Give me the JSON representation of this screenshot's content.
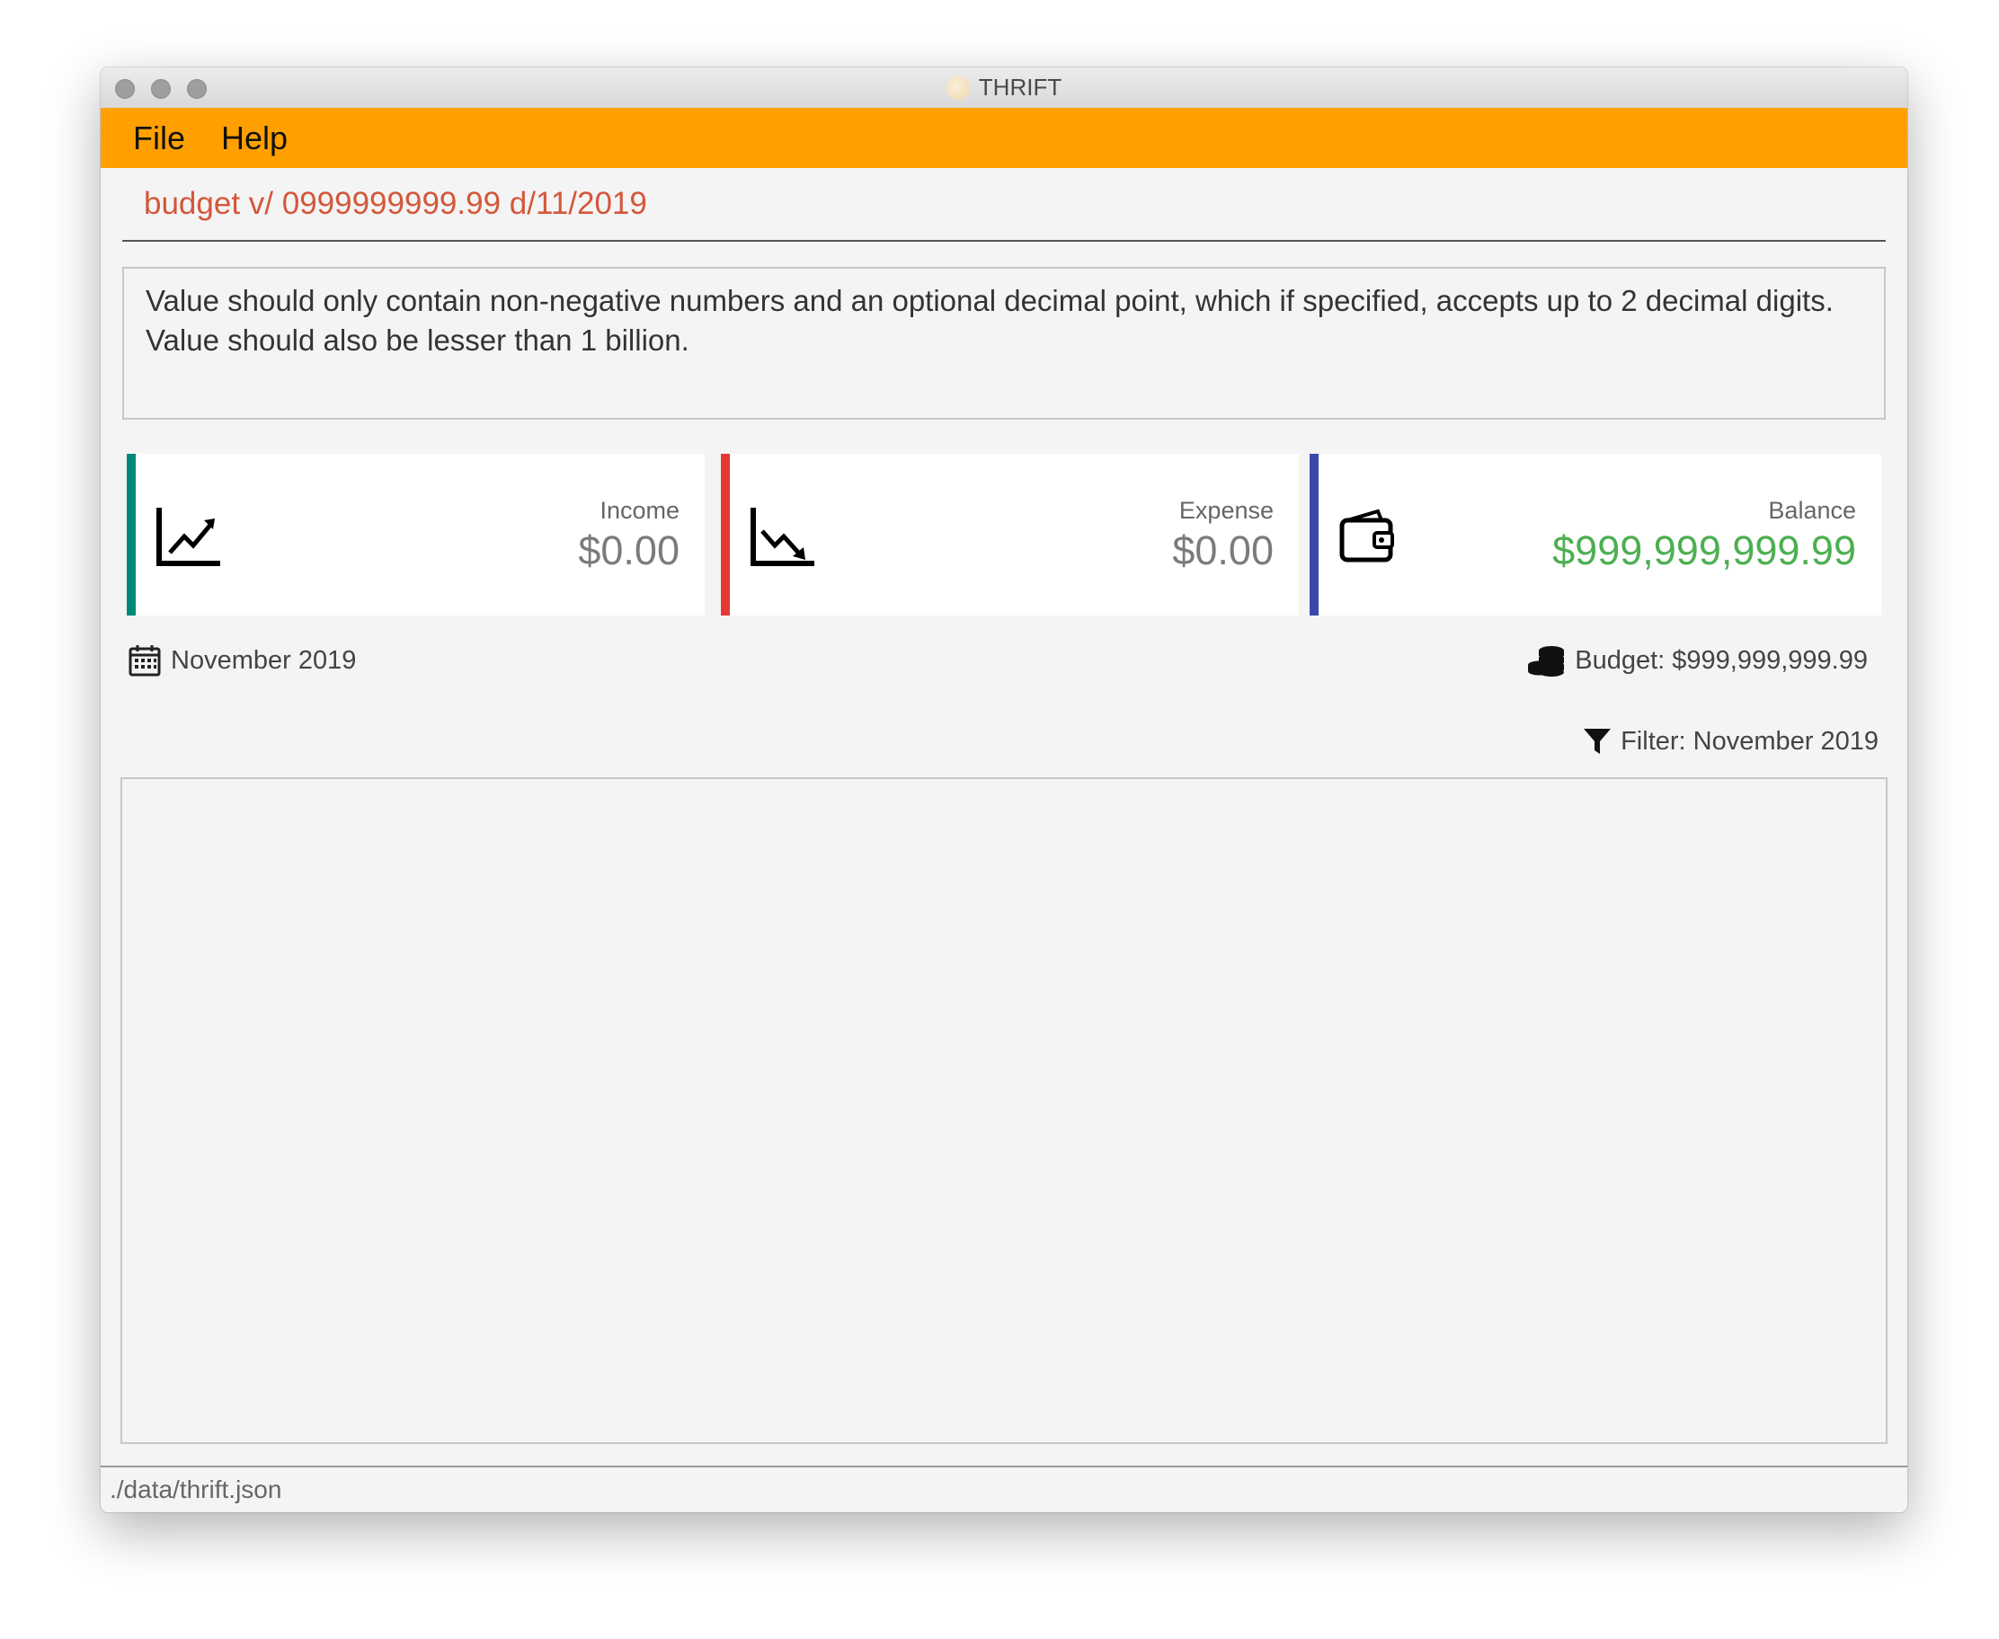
{
  "window": {
    "title": "THRIFT"
  },
  "menu": {
    "items": [
      "File",
      "Help"
    ]
  },
  "command": {
    "value": "budget v/ 0999999999.99 d/11/2019"
  },
  "result": {
    "lines": [
      "Value should only contain non-negative numbers and an optional decimal point, which if specified, accepts up to 2 decimal digits.",
      "Value should also be lesser than 1 billion."
    ]
  },
  "cards": {
    "income": {
      "label": "Income",
      "value": "$0.00",
      "color": "#00897b",
      "icon": "trending-up-icon"
    },
    "expense": {
      "label": "Expense",
      "value": "$0.00",
      "color": "#e53935",
      "icon": "trending-down-icon"
    },
    "balance": {
      "label": "Balance",
      "value": "$999,999,999.99",
      "color": "#3949ab",
      "value_color": "#4caf50",
      "icon": "wallet-icon"
    }
  },
  "month": {
    "text": "November 2019",
    "icon": "calendar-icon"
  },
  "budget": {
    "text": "Budget: $999,999,999.99",
    "icon": "coins-icon"
  },
  "filter": {
    "text": "Filter: November 2019",
    "icon": "filter-icon"
  },
  "status": {
    "path": "./data/thrift.json"
  },
  "colors": {
    "menubar": "#ffa000",
    "command_text": "#d4573a"
  }
}
